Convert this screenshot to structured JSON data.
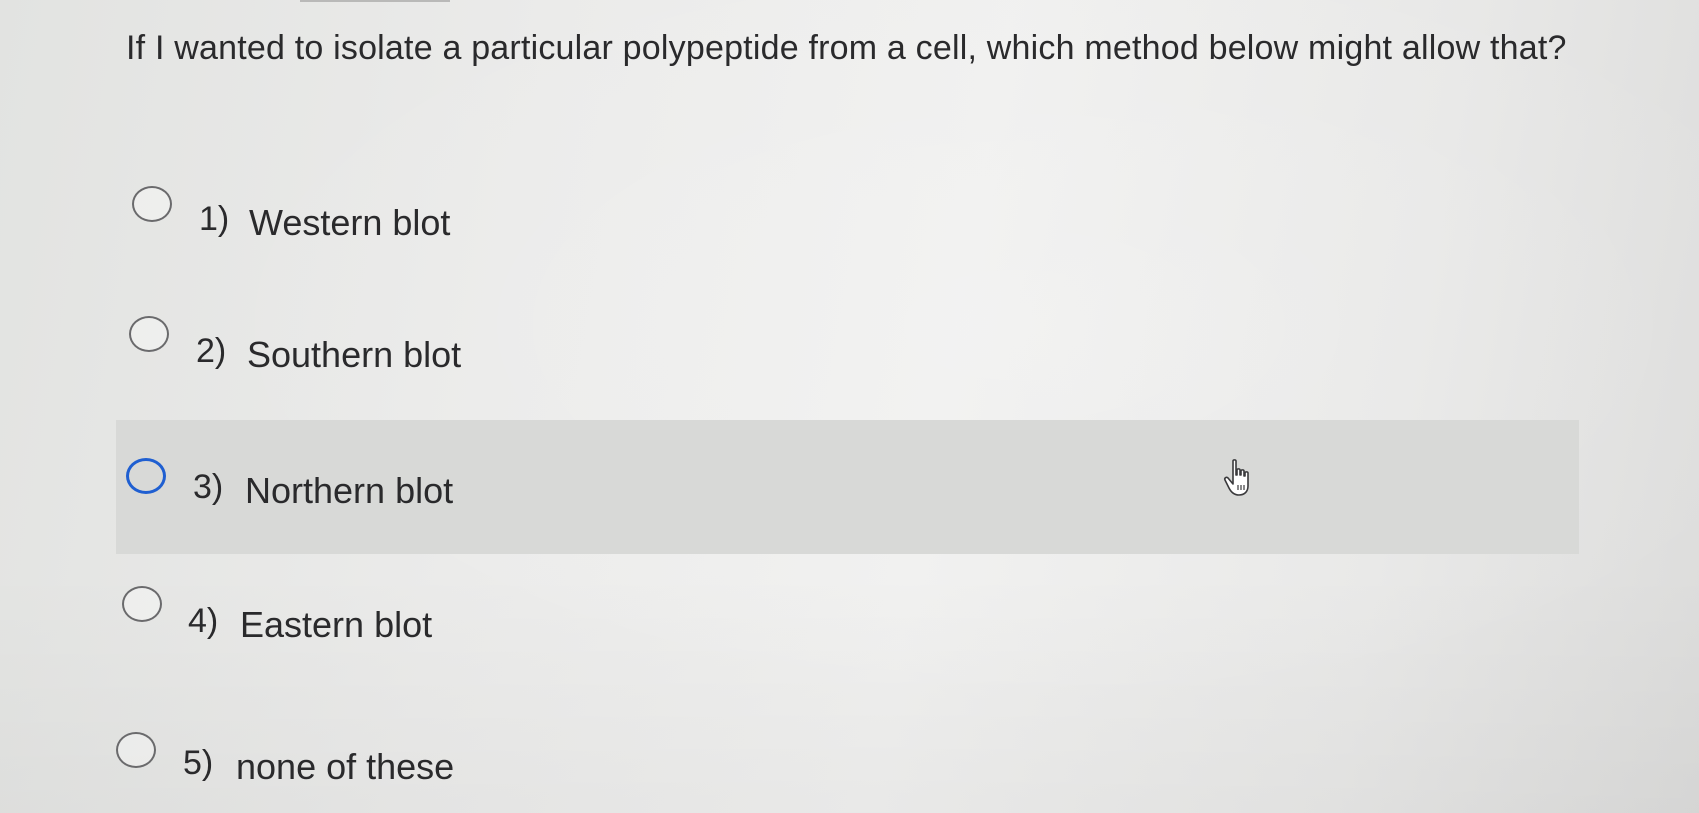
{
  "question": {
    "text": "If I wanted to isolate a particular polypeptide from a cell, which method below might allow that?"
  },
  "options": [
    {
      "number": "1)",
      "label": "Western blot",
      "selected": false,
      "highlighted": false
    },
    {
      "number": "2)",
      "label": "Southern blot",
      "selected": false,
      "highlighted": false
    },
    {
      "number": "3)",
      "label": "Northern blot",
      "selected": false,
      "highlighted": true
    },
    {
      "number": "4)",
      "label": "Eastern blot",
      "selected": false,
      "highlighted": false
    },
    {
      "number": "5)",
      "label": "none of these",
      "selected": false,
      "highlighted": false
    }
  ],
  "colors": {
    "focus_ring": "#1f5fd1",
    "highlight_row": "#d8d9d7",
    "text": "#2a2a2c"
  },
  "cursor_icon": "hand-pointer-icon"
}
